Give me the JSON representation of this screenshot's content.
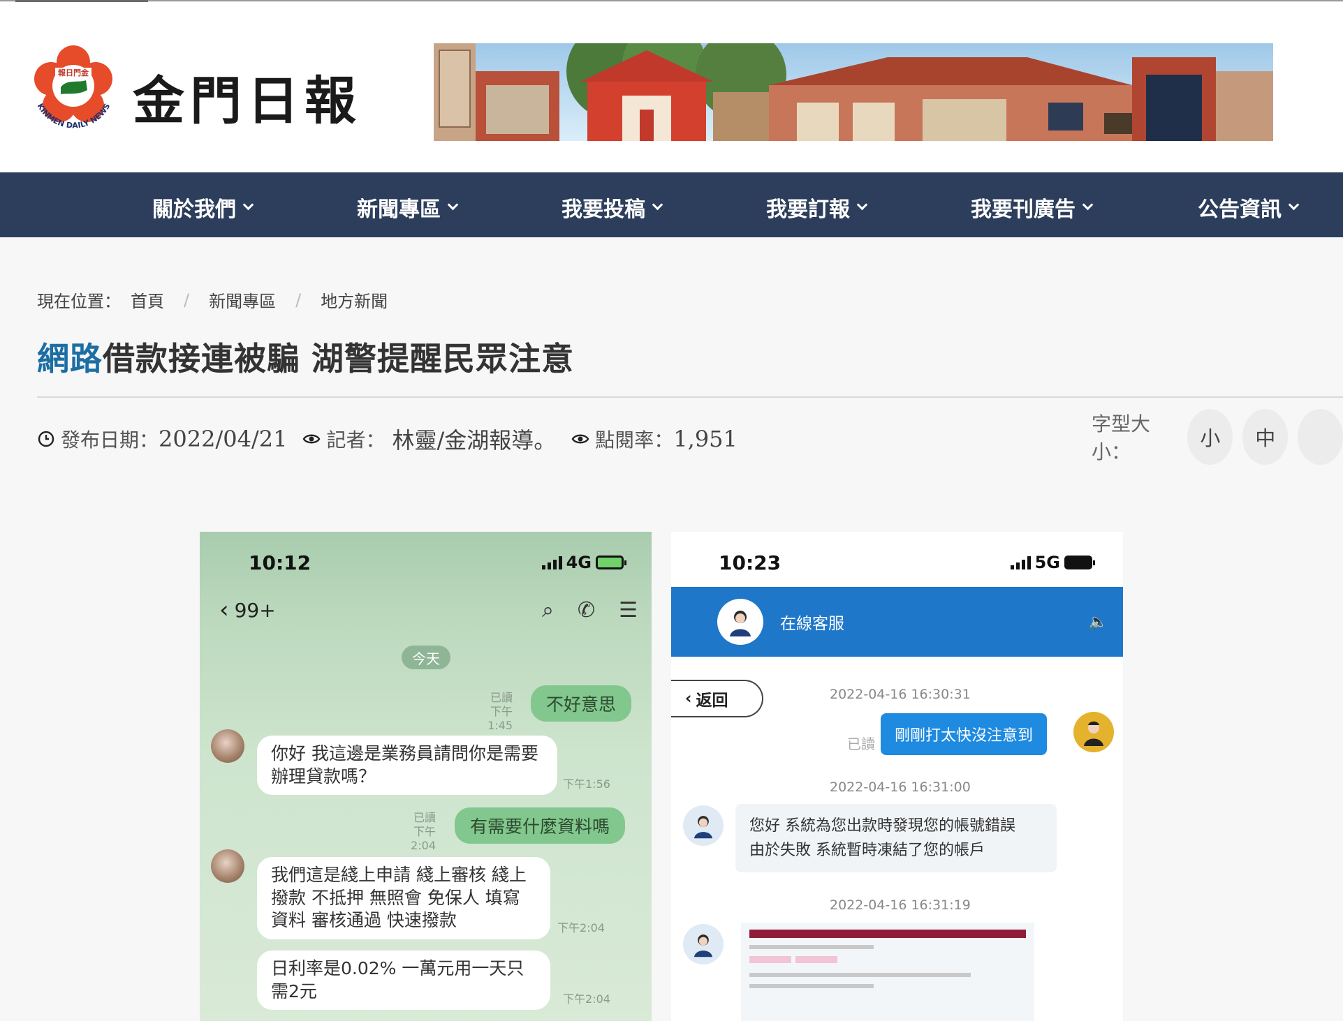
{
  "site": {
    "brand": "金門日報",
    "logo_text_top": "報日門金",
    "logo_text_bottom": "KINMEN DAILY NEWS"
  },
  "nav": {
    "items": [
      {
        "label": "關於我們"
      },
      {
        "label": "新聞專區"
      },
      {
        "label": "我要投稿"
      },
      {
        "label": "我要訂報"
      },
      {
        "label": "我要刊廣告"
      },
      {
        "label": "公告資訊"
      }
    ]
  },
  "breadcrumb": {
    "prefix": "現在位置：",
    "items": [
      "首頁",
      "新聞專區",
      "地方新聞"
    ],
    "separator": "/"
  },
  "article": {
    "title_highlight": "網路",
    "title_rest": "借款接連被騙 湖警提醒民眾注意",
    "meta": {
      "date_label": "發布日期：",
      "date_value": "2022/04/21",
      "reporter_label": "記者：",
      "reporter_value": "林靈/金湖報導。",
      "views_label": "點閱率：",
      "views_value": "1,951"
    },
    "font_size": {
      "label": "字型大小：",
      "small": "小",
      "medium": "中"
    }
  },
  "image_left": {
    "time": "10:12",
    "network": "4G",
    "back_count": "99+",
    "date_pill": "今天",
    "messages": [
      {
        "dir": "out",
        "text": "不好意思",
        "read": "已讀",
        "time": "下午1:45"
      },
      {
        "dir": "in",
        "text": "你好 我這邊是業務員請問你是需要辦理貸款嗎？",
        "time": "下午1:56"
      },
      {
        "dir": "out",
        "text": "有需要什麼資料嗎",
        "read": "已讀",
        "time": "下午2:04"
      },
      {
        "dir": "in",
        "text": "我們這是綫上申請 綫上審核 綫上撥款 不抵押 無照會 免保人 填寫資料 審核通過 快速撥款",
        "time": "下午2:04"
      },
      {
        "dir": "in",
        "text": "日利率是0.02% 一萬元用一天只需2元",
        "time": "下午2:04"
      }
    ]
  },
  "image_right": {
    "time": "10:23",
    "network": "5G",
    "header_title": "在線客服",
    "back_label": "返回",
    "timestamps": [
      "2022-04-16 16:30:31",
      "2022-04-16 16:31:00",
      "2022-04-16 16:31:19"
    ],
    "user_message": "剛剛打太快沒注意到",
    "read_tag": "已讀",
    "agent_message_line1": "您好 系統為您出款時發現您的帳號錯誤",
    "agent_message_line2": "由於失敗 系統暫時凍結了您的帳戶"
  },
  "colors": {
    "nav_bg": "#2c3e5b",
    "title_highlight": "#1c6ea4",
    "cs_blue": "#1e77c9",
    "line_green": "#82c78e"
  }
}
